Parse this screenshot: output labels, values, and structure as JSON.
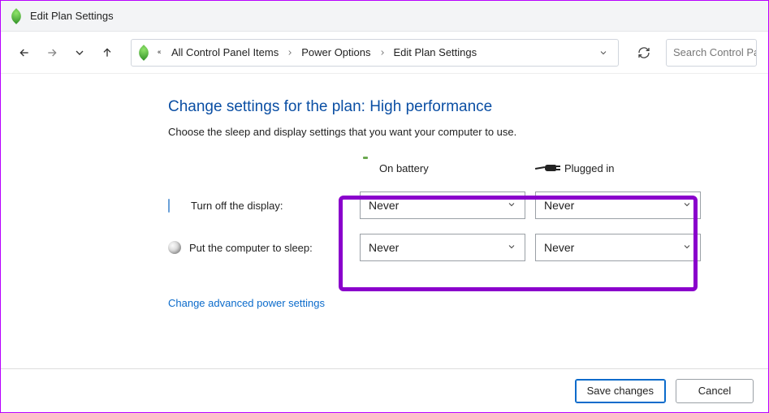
{
  "window": {
    "title": "Edit Plan Settings"
  },
  "breadcrumb": {
    "items": [
      "All Control Panel Items",
      "Power Options",
      "Edit Plan Settings"
    ]
  },
  "search": {
    "placeholder": "Search Control Panel"
  },
  "page": {
    "title": "Change settings for the plan: High performance",
    "subtitle": "Choose the sleep and display settings that you want your computer to use."
  },
  "columns": {
    "battery": "On battery",
    "plugged": "Plugged in"
  },
  "rows": {
    "display": {
      "label": "Turn off the display:",
      "battery_value": "Never",
      "plugged_value": "Never"
    },
    "sleep": {
      "label": "Put the computer to sleep:",
      "battery_value": "Never",
      "plugged_value": "Never"
    }
  },
  "links": {
    "advanced": "Change advanced power settings"
  },
  "buttons": {
    "save": "Save changes",
    "cancel": "Cancel"
  }
}
